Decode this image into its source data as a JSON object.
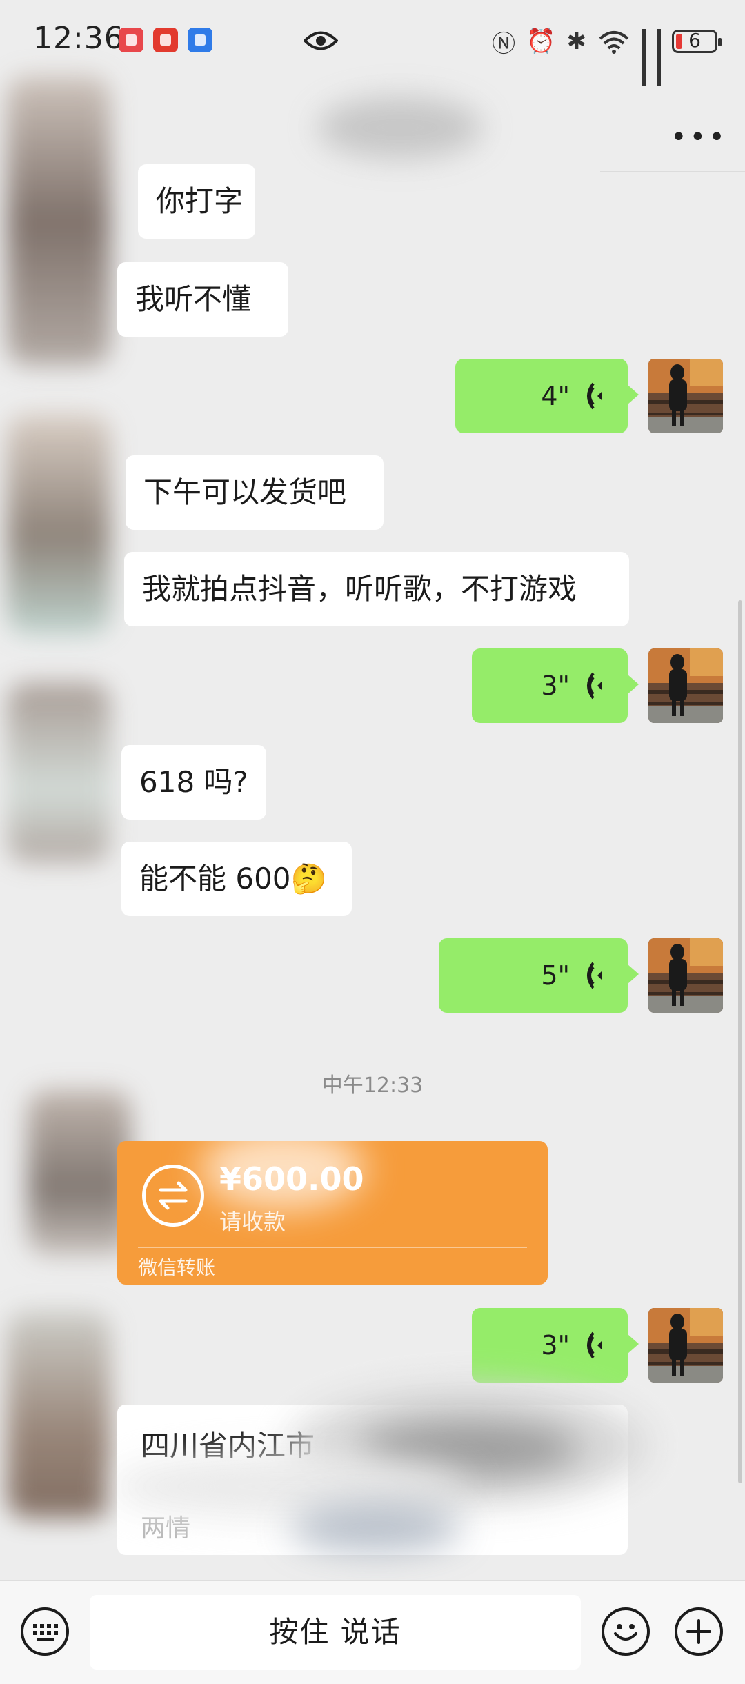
{
  "status_bar": {
    "time": "12:36",
    "battery": "6"
  },
  "messages": {
    "in_1": "你打字",
    "in_2": "我听不懂",
    "out_1": "4\"",
    "in_3": "下午可以发货吧",
    "in_4": "我就拍点抖音，听听歌，不打游戏",
    "out_2": "3\"",
    "in_5": "618 吗?",
    "in_6": "能不能 600🤔",
    "out_3": "5\"",
    "timestamp": "中午12:33",
    "out_4": "3\"",
    "address_line1": "四川省内江市",
    "address_line3": "两情"
  },
  "transfer": {
    "amount": "¥600.00",
    "status": "请收款",
    "brand": "微信转账"
  },
  "input_bar": {
    "talk_label": "按住 说话"
  },
  "colors": {
    "background": "#ededed",
    "outgoing_bubble": "#95ec69",
    "incoming_bubble": "#ffffff",
    "transfer_card": "#f69c3b"
  }
}
